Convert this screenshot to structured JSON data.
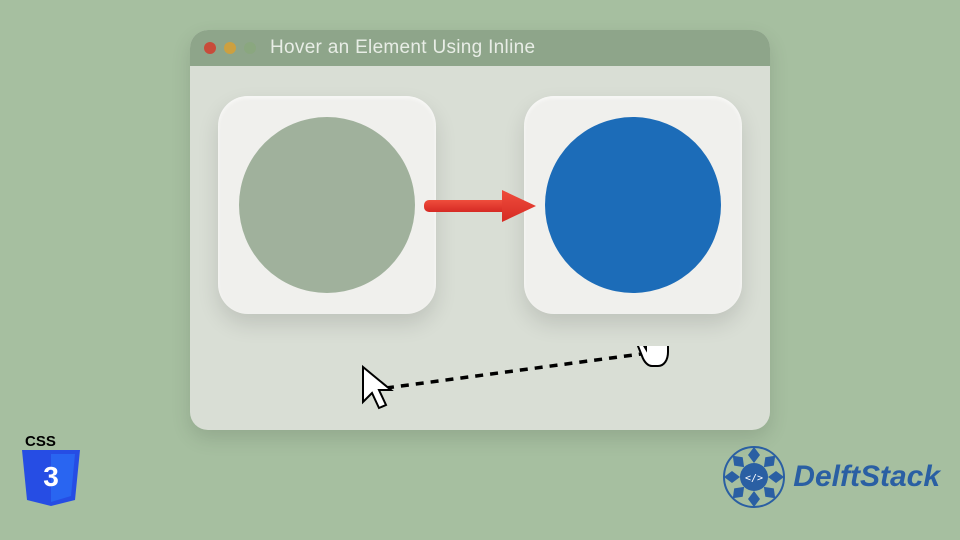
{
  "window": {
    "title": "Hover an Element Using Inline"
  },
  "colors": {
    "background": "#a6bfa0",
    "windowBody": "#d9ded5",
    "titlebar": "#8ea58a",
    "tile": "#f0f0ed",
    "circleDefault": "#a0b19c",
    "circleHover": "#1c6cb8",
    "arrow": "#e3352e",
    "css3Shield": "#264DE4",
    "css3ShieldLight": "#2965F1",
    "delftBlue": "#2a5fa3"
  },
  "badges": {
    "css3Label": "CSS",
    "css3Number": "3",
    "delftName": "DelftStack"
  },
  "diagram": {
    "leftState": "default",
    "rightState": "hover"
  }
}
